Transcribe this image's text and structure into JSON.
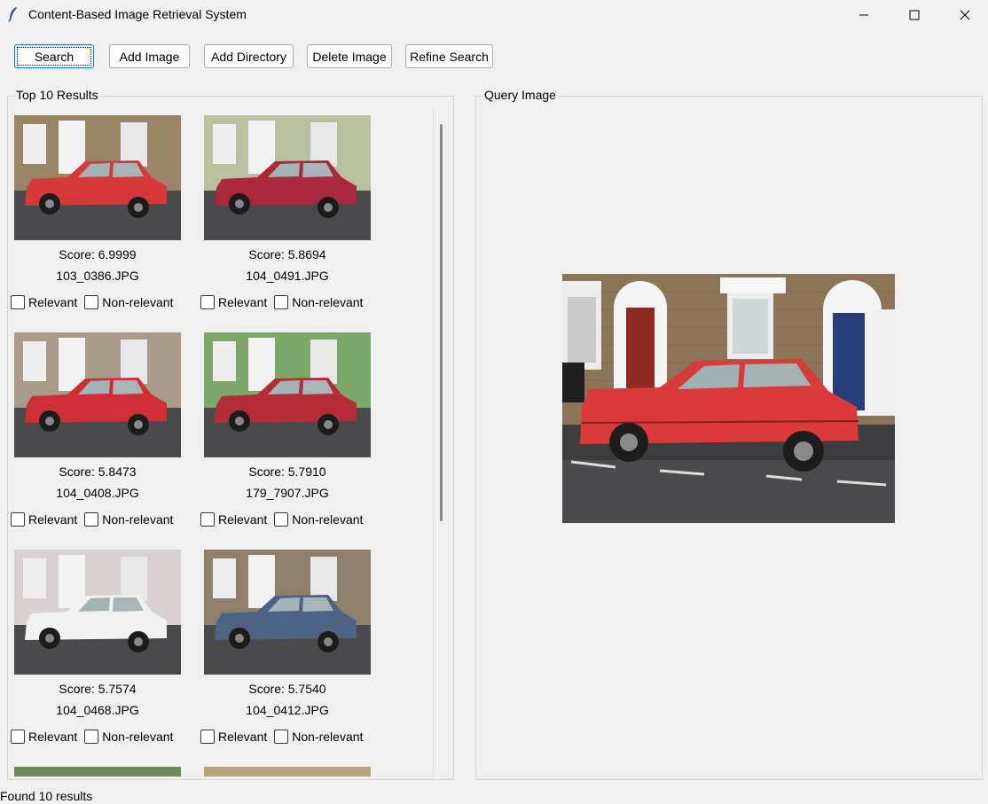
{
  "window": {
    "title": "Content-Based Image Retrieval System",
    "icon": "feather-icon"
  },
  "toolbar": {
    "search_label": "Search",
    "add_image_label": "Add Image",
    "add_directory_label": "Add Directory",
    "delete_image_label": "Delete Image",
    "refine_search_label": "Refine Search"
  },
  "results_panel": {
    "title": "Top 10 Results",
    "relevant_label": "Relevant",
    "non_relevant_label": "Non-relevant",
    "items": [
      {
        "score": "Score: 6.9999",
        "filename": "103_0386.JPG",
        "car_color": "#d6393a"
      },
      {
        "score": "Score: 5.8694",
        "filename": "104_0491.JPG",
        "car_color": "#a9283a"
      },
      {
        "score": "Score: 5.8473",
        "filename": "104_0408.JPG",
        "car_color": "#cf2f34"
      },
      {
        "score": "Score: 5.7910",
        "filename": "179_7907.JPG",
        "car_color": "#b52b37"
      },
      {
        "score": "Score: 5.7574",
        "filename": "104_0468.JPG",
        "car_color": "#f2f2f2"
      },
      {
        "score": "Score: 5.7540",
        "filename": "104_0412.JPG",
        "car_color": "#4d6383"
      }
    ]
  },
  "query_panel": {
    "title": "Query Image"
  },
  "status": {
    "text": "Found 10 results"
  }
}
